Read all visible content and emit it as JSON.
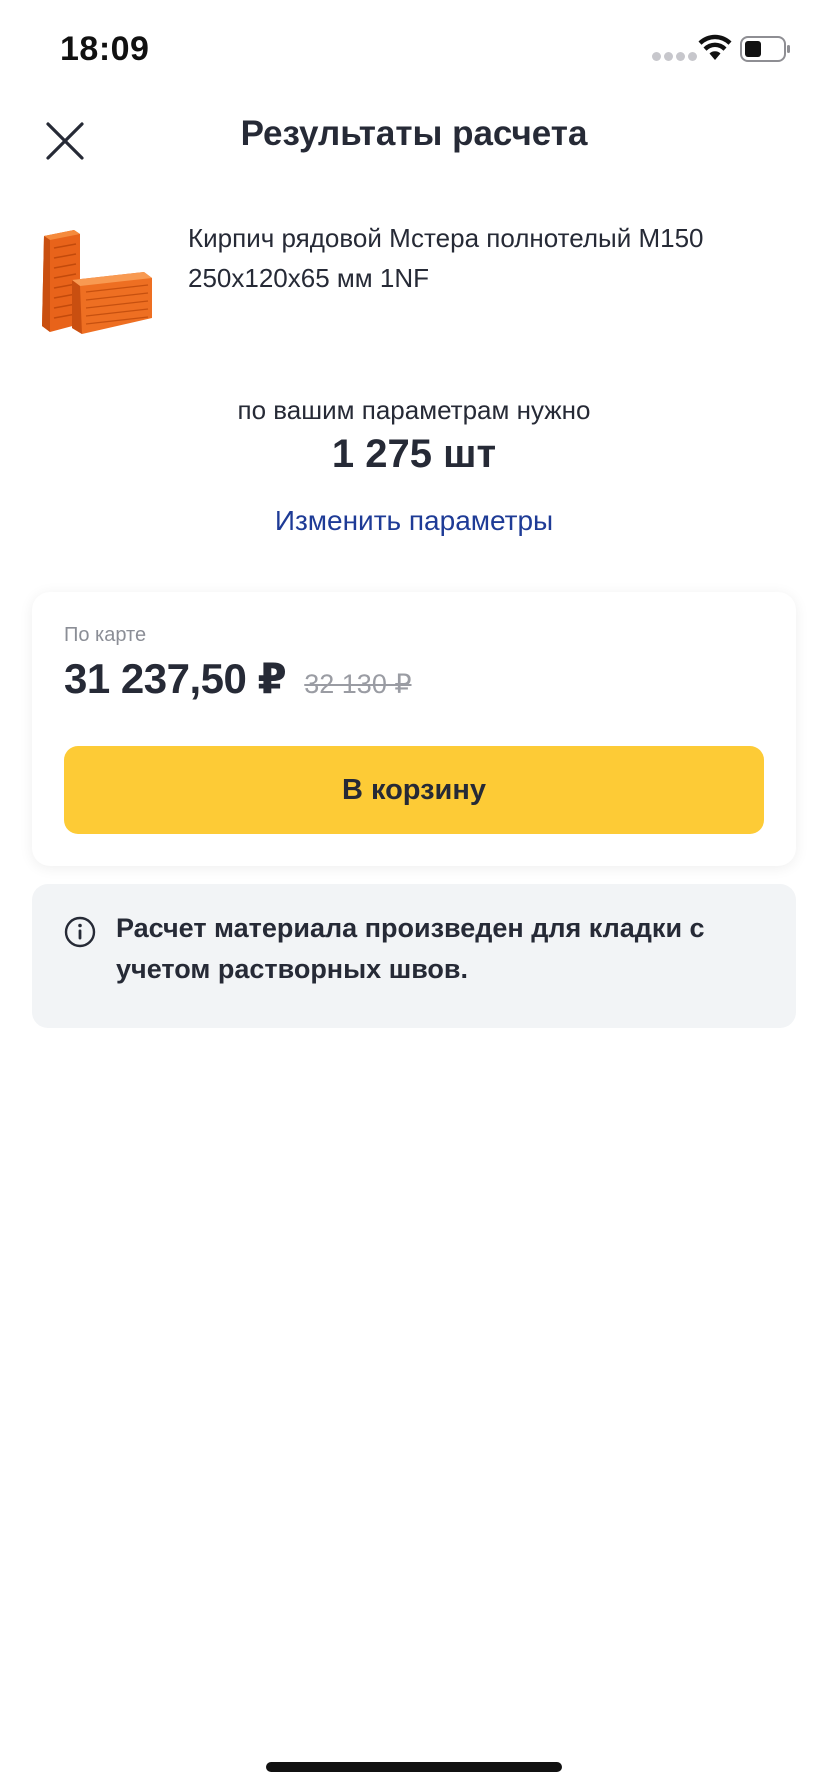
{
  "status_bar": {
    "time": "18:09"
  },
  "header": {
    "title": "Результаты расчета",
    "close_icon": "close-icon"
  },
  "product": {
    "name": "Кирпич рядовой Мстера полнотелый М150 250x120x65 мм 1NF",
    "image": "brick-image"
  },
  "result": {
    "caption": "по вашим параметрам нужно",
    "amount": "1 275 шт",
    "change_link": "Изменить параметры"
  },
  "price": {
    "label": "По карте",
    "current": "31 237,50 ₽",
    "old": "32 130 ₽",
    "cart_button": "В корзину"
  },
  "info": {
    "icon": "info-icon",
    "text": "Расчет материала произведен для кладки с учетом растворных швов."
  },
  "colors": {
    "accent_yellow": "#fdcb36",
    "link_blue": "#1e3b96",
    "text_dark": "#262a36",
    "muted_gray": "#8b8e96",
    "info_bg": "#f2f4f6"
  }
}
